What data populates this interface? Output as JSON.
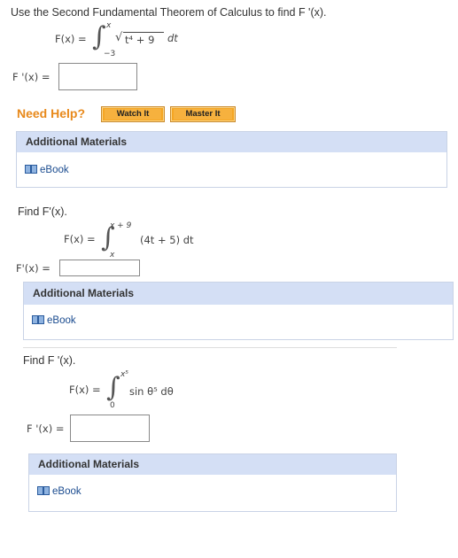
{
  "problem1": {
    "prompt": "Use the Second Fundamental Theorem of Calculus to find F '(x).",
    "fx_label": "F(x) =",
    "upper": "x",
    "lower": "−3",
    "integrand": "t⁴ + 9",
    "dt": "dt",
    "answer_label": "F '(x) =",
    "answer_value": ""
  },
  "need_help": {
    "label": "Need Help?",
    "watch": "Watch It",
    "master": "Master It"
  },
  "additional_materials_label": "Additional Materials",
  "ebook_label": "eBook",
  "problem2": {
    "prompt": "Find F'(x).",
    "fx_label": "F(x) =",
    "upper": "x + 9",
    "lower": "x",
    "integrand": "(4t + 5) dt",
    "answer_label": "F'(x) =",
    "answer_value": ""
  },
  "problem3": {
    "prompt": "Find  F '(x).",
    "fx_label": "F(x) =",
    "upper": "x⁵",
    "lower": "0",
    "integrand": "sin θ⁵ dθ",
    "answer_label": "F '(x) =",
    "answer_value": ""
  },
  "colors": {
    "need_help": "#e8891b",
    "button_fill": "#f5a623",
    "panel_header": "#d4dff5",
    "ebook_link": "#1a4b8f"
  },
  "icons": [
    "book-icon"
  ]
}
